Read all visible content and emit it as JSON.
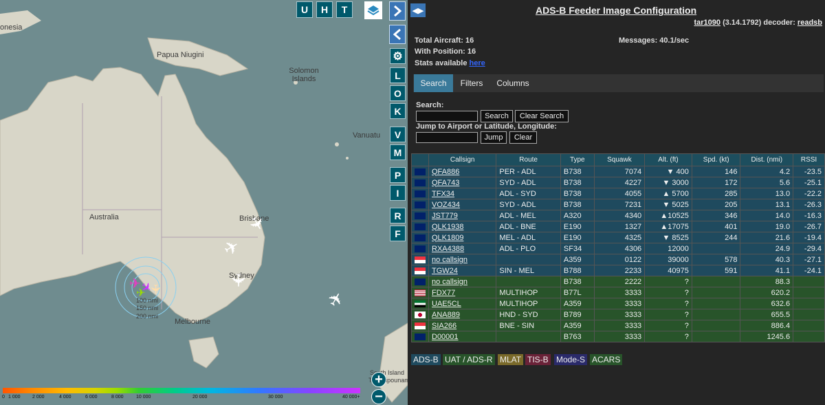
{
  "map": {
    "labels": {
      "indonesia": "onesia",
      "papua": "Papua Niugini",
      "solomon": "Solomon Islands",
      "vanuatu": "Vanuatu",
      "australia": "Australia",
      "brisbane": "Brisbane",
      "sydney": "Sydney",
      "melbourne": "Melbourne",
      "south_island": "South Island",
      "te_waipounamu": "Te Waipounamu"
    },
    "range_rings": [
      "100 nmi",
      "150 nmi",
      "200 nmi"
    ],
    "top_buttons": [
      "U",
      "H",
      "T"
    ],
    "side_buttons": [
      "L",
      "O",
      "K",
      "V",
      "M",
      "P",
      "I",
      "R",
      "F"
    ],
    "altitude_legend": [
      "0",
      "1 000",
      "2 000",
      "4 000",
      "6 000",
      "8 000",
      "10 000",
      "20 000",
      "30 000",
      "40 000+"
    ]
  },
  "panel": {
    "title": "ADS-B Feeder Image Configuration",
    "version_link": "tar1090",
    "version_text": "(3.14.1792) decoder:",
    "decoder_link": "readsb",
    "total_aircraft": "Total Aircraft: 16",
    "with_position": "With Position: 16",
    "stats_text": "Stats available",
    "stats_link": "here",
    "messages": "Messages: 40.1/sec",
    "tabs": [
      "Search",
      "Filters",
      "Columns"
    ],
    "search_label": "Search:",
    "search_button": "Search",
    "clear_search_button": "Clear Search",
    "jump_label": "Jump to Airport or Latitude, Longitude:",
    "jump_button": "Jump",
    "clear_button": "Clear"
  },
  "table": {
    "columns": [
      "Callsign",
      "Route",
      "Type",
      "Squawk",
      "Alt. (ft)",
      "Spd. (kt)",
      "Dist. (nmi)",
      "RSSI"
    ],
    "rows": [
      {
        "flag": "AU",
        "callsign": "QFA886",
        "route": "PER - ADL",
        "type": "B738",
        "squawk": "7074",
        "alt": "▼  400",
        "spd": "146",
        "dist": "4.2",
        "rssi": "-23.5",
        "src": "adsb"
      },
      {
        "flag": "AU",
        "callsign": "QFA743",
        "route": "SYD - ADL",
        "type": "B738",
        "squawk": "4227",
        "alt": "▼ 3000",
        "spd": "172",
        "dist": "5.6",
        "rssi": "-25.1",
        "src": "adsb"
      },
      {
        "flag": "AU",
        "callsign": "TFX34",
        "route": "ADL - SYD",
        "type": "B738",
        "squawk": "4055",
        "alt": "▲ 5700",
        "spd": "285",
        "dist": "13.0",
        "rssi": "-22.2",
        "src": "adsb"
      },
      {
        "flag": "AU",
        "callsign": "VOZ434",
        "route": "SYD - ADL",
        "type": "B738",
        "squawk": "7231",
        "alt": "▼ 5025",
        "spd": "205",
        "dist": "13.1",
        "rssi": "-26.3",
        "src": "adsb"
      },
      {
        "flag": "AU",
        "callsign": "JST779",
        "route": "ADL - MEL",
        "type": "A320",
        "squawk": "4340",
        "alt": "▲10525",
        "spd": "346",
        "dist": "14.0",
        "rssi": "-16.3",
        "src": "adsb"
      },
      {
        "flag": "AU",
        "callsign": "QLK1938",
        "route": "ADL - BNE",
        "type": "E190",
        "squawk": "1327",
        "alt": "▲17075",
        "spd": "401",
        "dist": "19.0",
        "rssi": "-26.7",
        "src": "adsb"
      },
      {
        "flag": "AU",
        "callsign": "QLK1809",
        "route": "MEL - ADL",
        "type": "E190",
        "squawk": "4325",
        "alt": "▼ 8525",
        "spd": "244",
        "dist": "21.6",
        "rssi": "-19.4",
        "src": "adsb"
      },
      {
        "flag": "AU",
        "callsign": "RXA4388",
        "route": "ADL - PLO",
        "type": "SF34",
        "squawk": "4306",
        "alt": "12000",
        "spd": "",
        "dist": "24.9",
        "rssi": "-29.4",
        "src": "adsb"
      },
      {
        "flag": "SG",
        "callsign": "no callsign",
        "route": "",
        "type": "A359",
        "squawk": "0122",
        "alt": "39000",
        "spd": "578",
        "dist": "40.3",
        "rssi": "-27.1",
        "src": "adsb"
      },
      {
        "flag": "SG",
        "callsign": "TGW24",
        "route": "SIN - MEL",
        "type": "B788",
        "squawk": "2233",
        "alt": "40975",
        "spd": "591",
        "dist": "41.1",
        "rssi": "-24.1",
        "src": "adsb"
      },
      {
        "flag": "AU",
        "callsign": "no callsign",
        "route": "",
        "type": "B738",
        "squawk": "2222",
        "alt": "?",
        "spd": "",
        "dist": "88.3",
        "rssi": "",
        "src": "other"
      },
      {
        "flag": "US",
        "callsign": "FDX77",
        "route": "MULTIHOP",
        "type": "B77L",
        "squawk": "3333",
        "alt": "?",
        "spd": "",
        "dist": "620.2",
        "rssi": "",
        "src": "other"
      },
      {
        "flag": "AE",
        "callsign": "UAE5CL",
        "route": "MULTIHOP",
        "type": "A359",
        "squawk": "3333",
        "alt": "?",
        "spd": "",
        "dist": "632.6",
        "rssi": "",
        "src": "other"
      },
      {
        "flag": "JP",
        "callsign": "ANA889",
        "route": "HND - SYD",
        "type": "B789",
        "squawk": "3333",
        "alt": "?",
        "spd": "",
        "dist": "655.5",
        "rssi": "",
        "src": "other"
      },
      {
        "flag": "SG",
        "callsign": "SIA266",
        "route": "BNE - SIN",
        "type": "A359",
        "squawk": "3333",
        "alt": "?",
        "spd": "",
        "dist": "886.4",
        "rssi": "",
        "src": "other"
      },
      {
        "flag": "AU",
        "callsign": "D00001",
        "route": "",
        "type": "B763",
        "squawk": "3333",
        "alt": "?",
        "spd": "",
        "dist": "1245.6",
        "rssi": "",
        "src": "other"
      }
    ]
  },
  "source_legend": [
    {
      "label": "ADS-B",
      "color": "#1f4a5e",
      "text": "#eee"
    },
    {
      "label": "UAT / ADS-R",
      "color": "#28542a",
      "text": "#eee"
    },
    {
      "label": "MLAT",
      "color": "#7a6a2a",
      "text": "#eee"
    },
    {
      "label": "TIS-B",
      "color": "#6a2238",
      "text": "#eee"
    },
    {
      "label": "Mode-S",
      "color": "#2a2a6a",
      "text": "#eee"
    },
    {
      "label": "ACARS",
      "color": "#28542a",
      "text": "#eee"
    }
  ]
}
